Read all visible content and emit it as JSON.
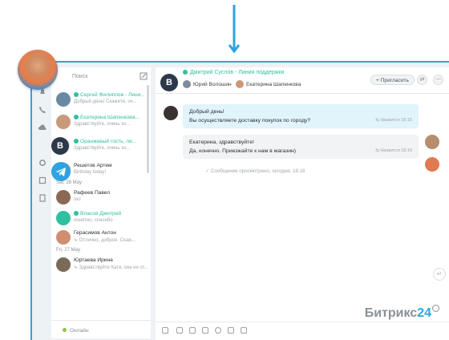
{
  "left_panel": {
    "search_placeholder": "Поиск",
    "items": [
      {
        "name": "Сергей Филиппов - Лини...",
        "message": "Добрый день! Скажите, оч...",
        "green": true
      },
      {
        "name": "Екатерина Шапенкова...",
        "message": "Здравствуйте, очень хо...",
        "green": true
      },
      {
        "name": "Оранжевый гость, ли...",
        "message": "Здравствуйте, очень хо...",
        "green": true
      },
      {
        "name": "Решетов Артем",
        "message": "Birthday today!",
        "green": false
      },
      {
        "name": "Рафеев Павел",
        "message": "окз",
        "green": false
      },
      {
        "name": "Власов Дмитрий",
        "message": "понятно, спасибо",
        "green": true
      },
      {
        "name": "Герасимов Антон",
        "message": "↳ Отлично, доброе. Скаж...",
        "green": false
      },
      {
        "name": "Юртаева Ирина",
        "message": "↳ Здравствуйте Катя, она не от...",
        "green": false
      }
    ],
    "date_separators": [
      "Sat, 28 May",
      "Fri, 27 May"
    ],
    "status": "Онлайн"
  },
  "chat": {
    "title": "Дмитрий Суслов - Линия поддержки",
    "members": [
      "Юрий Волошин",
      "Екатерина Шапенкова"
    ],
    "invite_label": "+ Пригласить",
    "messages": [
      {
        "line1": "Добрый день!",
        "line2": "Вы осуществляете доставку покупок по городу?",
        "time": "⇆ Нравится  18:15"
      },
      {
        "line1": "Екатерина, здравствуйте!",
        "line2": "Да, конечно. Приезжайте к нам в магазин)",
        "time": "⇆ Нравится  18:16"
      }
    ],
    "seen_text": "✓ Сообщение просмотрено, сегодня, 18:18"
  },
  "badges": {
    "label": "B"
  },
  "logo": {
    "text": "Битрикс",
    "number": "24"
  },
  "colors": {
    "accent": "#2fa3e0",
    "green": "#2fc0a0",
    "badge_bg": "#2b394a"
  }
}
